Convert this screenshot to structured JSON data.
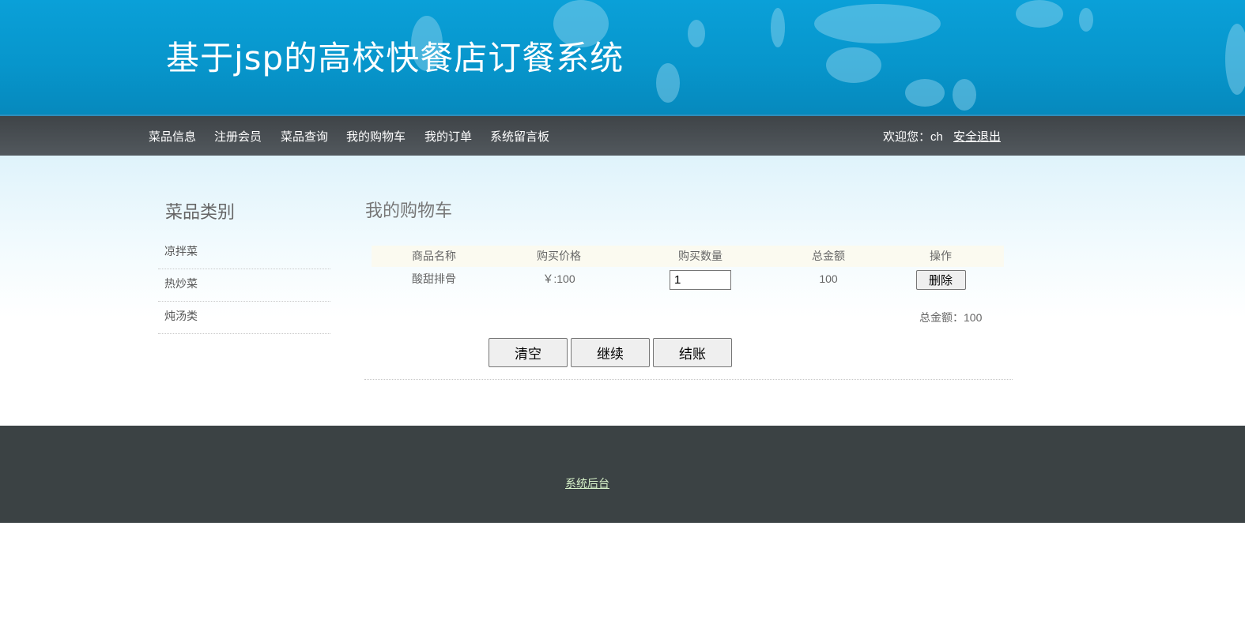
{
  "header": {
    "title": "基于jsp的高校快餐店订餐系统"
  },
  "nav": {
    "items": [
      "菜品信息",
      "注册会员",
      "菜品查询",
      "我的购物车",
      "我的订单",
      "系统留言板"
    ],
    "welcome": "欢迎您：ch",
    "logout": "安全退出"
  },
  "sidebar": {
    "title": "菜品类别",
    "categories": [
      "凉拌菜",
      "热炒菜",
      "炖汤类"
    ]
  },
  "cart": {
    "title": "我的购物车",
    "headers": [
      "商品名称",
      "购买价格",
      "购买数量",
      "总金额",
      "操作"
    ],
    "rows": [
      {
        "name": "酸甜排骨",
        "price": "￥:100",
        "quantity": "1",
        "total": "100",
        "action": "删除"
      }
    ],
    "total_label": "总金额：",
    "total_value": "100",
    "buttons": {
      "clear": "清空",
      "continue": "继续",
      "checkout": "结账"
    }
  },
  "footer": {
    "link": "系统后台"
  },
  "colors": {
    "banner": "#0796cc",
    "navbar": "#4a5055",
    "footer": "#3b4244",
    "footer_link": "#d7f2c9"
  }
}
